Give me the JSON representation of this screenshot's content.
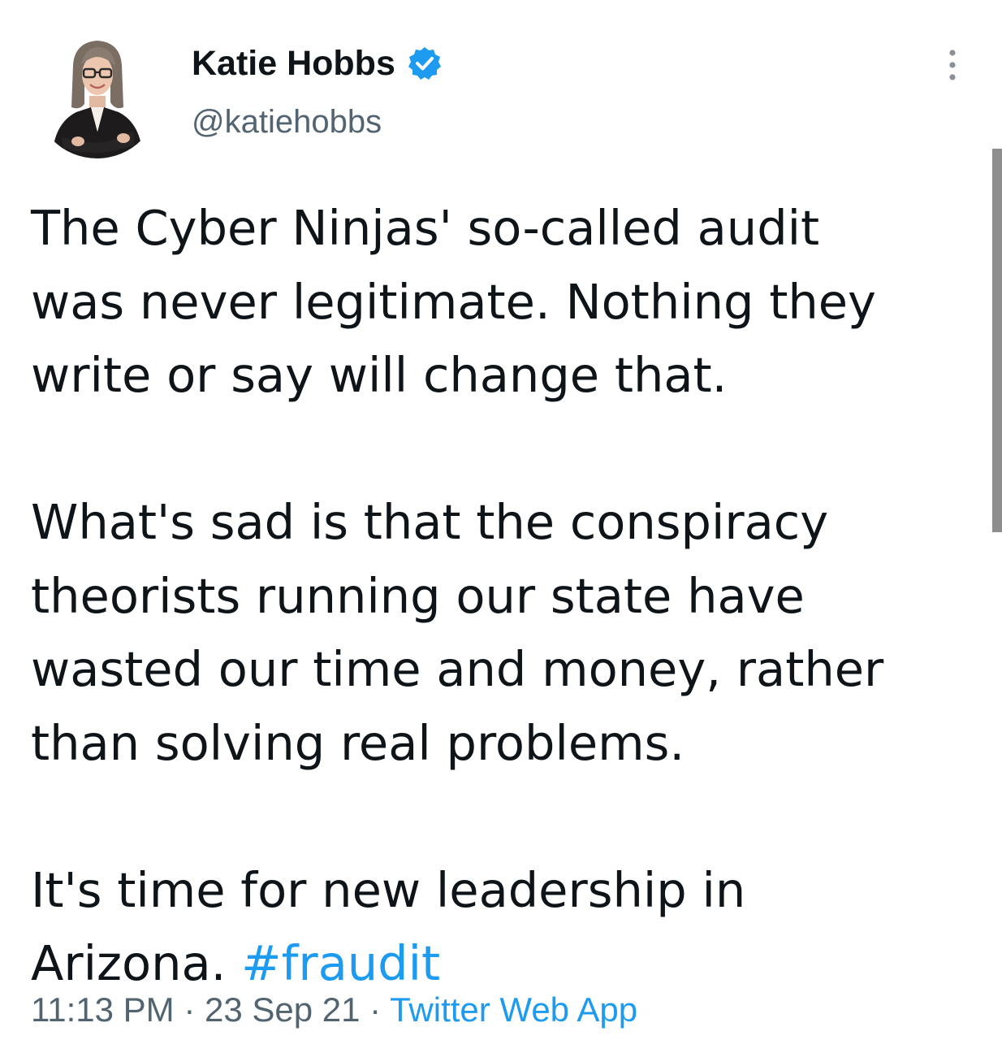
{
  "author": {
    "name": "Katie Hobbs",
    "handle": "@katiehobbs",
    "verified": true
  },
  "tweet": {
    "paragraph_1": "The Cyber Ninjas' so-called audit\nwas never legitimate. Nothing they\nwrite or say will change that.",
    "paragraph_2": "What's sad is that the conspiracy\ntheorists running our state have\nwasted our time and money, rather\nthan solving real problems.",
    "paragraph_3_text": "It's time for new leadership in\nArizona. ",
    "hashtag": "#fraudit"
  },
  "meta": {
    "time": "11:13 PM",
    "separator": " · ",
    "date": "23 Sep 21",
    "source": "Twitter Web App"
  },
  "icons": {
    "verified": "verified-badge-icon",
    "more": "more-vertical-icon"
  },
  "colors": {
    "text": "#0f1419",
    "secondary": "#536471",
    "link": "#1d9bf0",
    "verified": "#1d9bf0"
  }
}
